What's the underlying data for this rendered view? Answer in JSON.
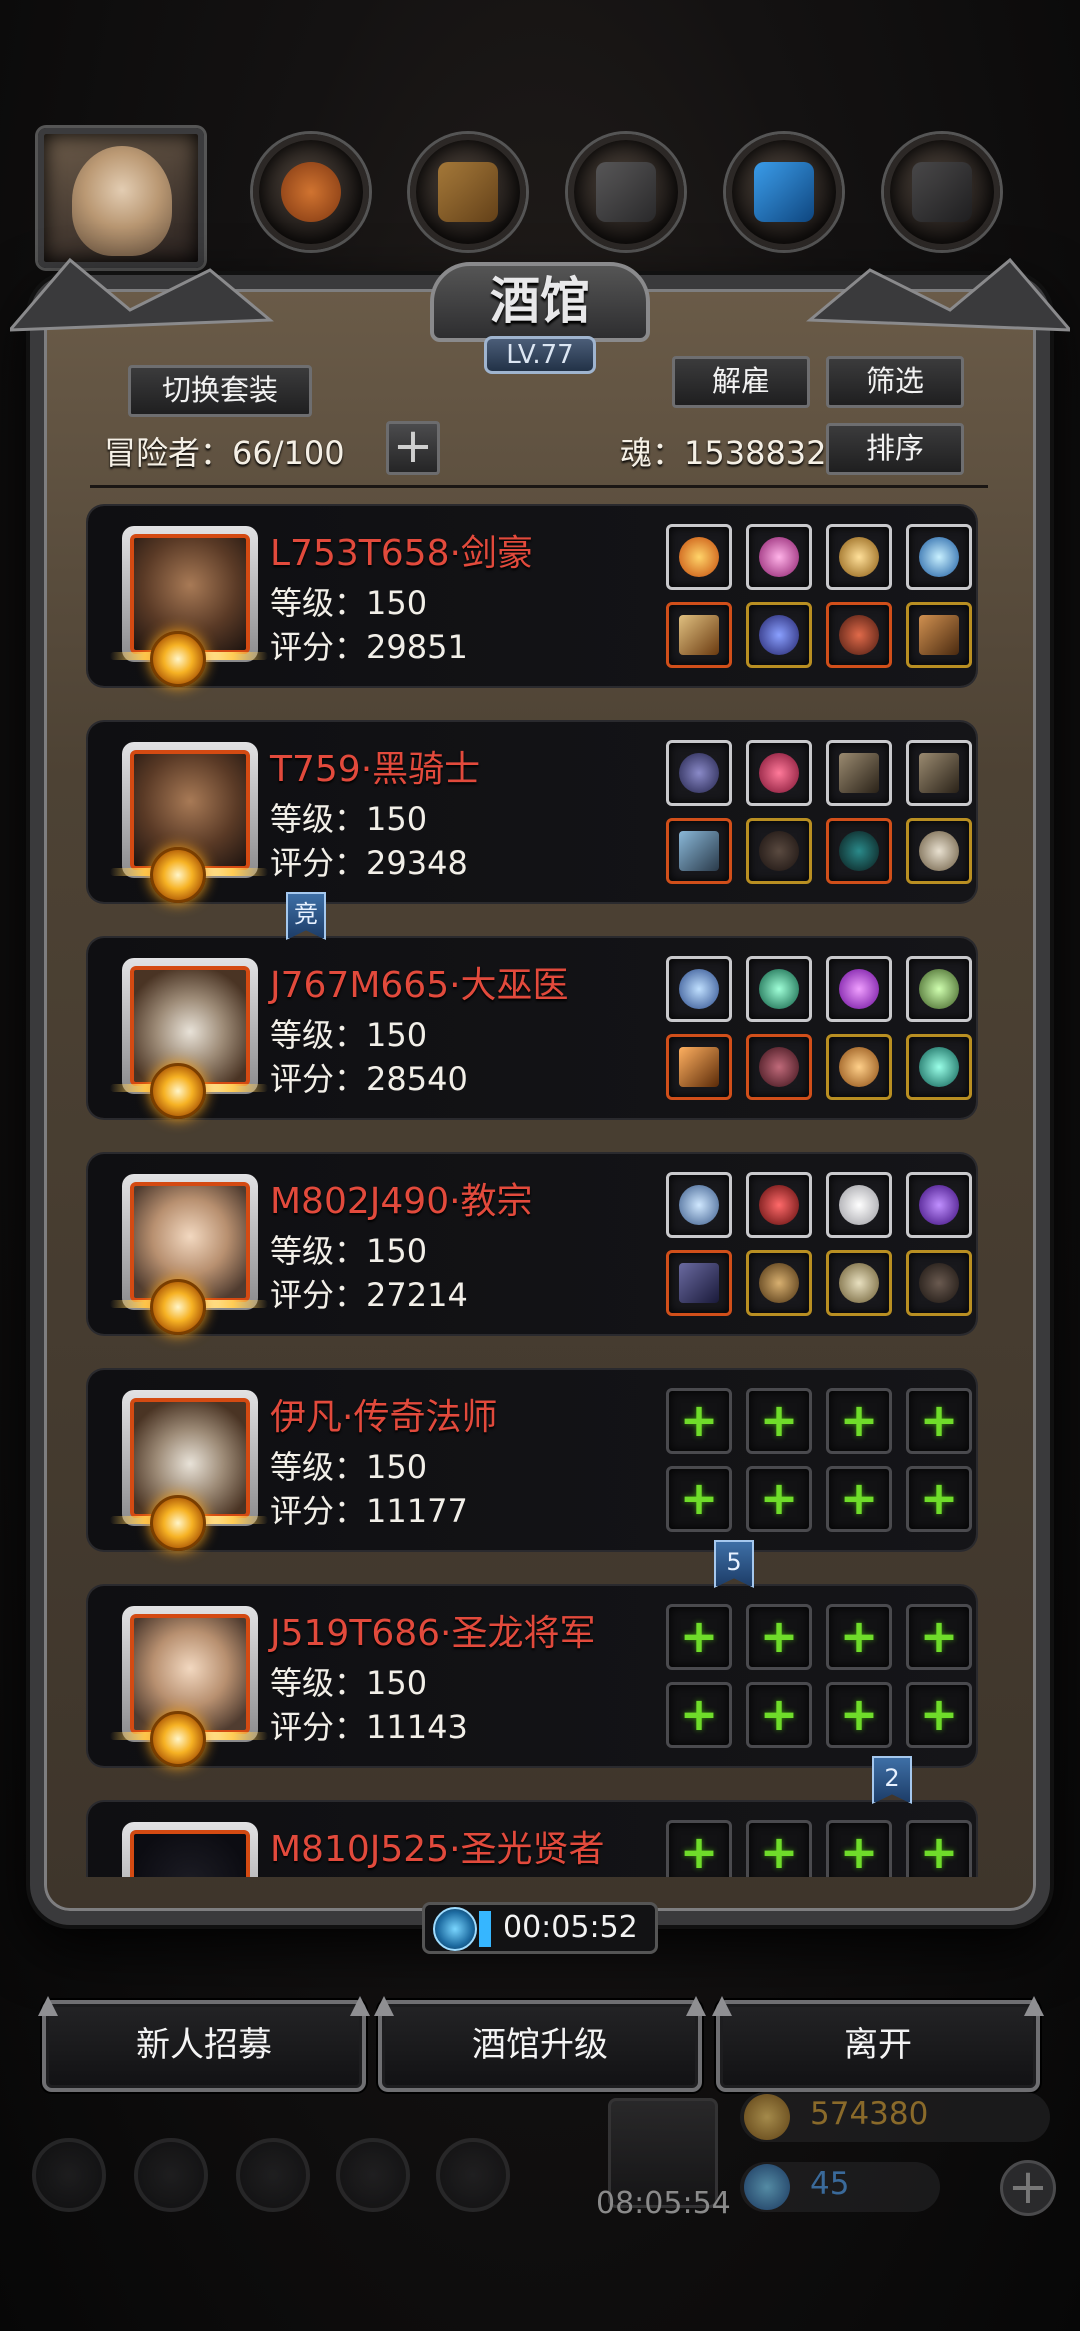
{
  "tavern": {
    "title": "酒馆",
    "level": "LV.77",
    "switch_outfit": "切换套装",
    "dismiss": "解雇",
    "filter": "筛选",
    "sort": "排序",
    "adventurers_label": "冒险者：66/100",
    "soul_label": "魂：1538832"
  },
  "heroes": [
    {
      "name": "L753T658·剑豪",
      "level": "等级：150",
      "score": "评分：29851",
      "portrait": "warrior",
      "slots": [
        "flame-ring",
        "pink-gem",
        "gold-charm",
        "blue-crystal",
        "sword",
        "blue-armor",
        "red-armor",
        "axe"
      ],
      "empty": false
    },
    {
      "name": "T759·黑骑士",
      "level": "等级：150",
      "score": "评分：29348",
      "portrait": "warrior",
      "slots": [
        "dark-helm",
        "ruby",
        "blade",
        "blade",
        "spear",
        "dark-armor",
        "dark-cloak",
        "amulet"
      ],
      "empty": false
    },
    {
      "name": "J767M665·大巫医",
      "level": "等级：150",
      "score": "评分：28540",
      "portrait": "old-mage",
      "slots": [
        "ice-aura",
        "jade-gem",
        "purple-gem",
        "lantern",
        "staff",
        "red-armor",
        "gold-ring",
        "teal-ring"
      ],
      "empty": false
    },
    {
      "name": "M802J490·教宗",
      "level": "等级：150",
      "score": "评分：27214",
      "portrait": "female",
      "slots": [
        "frost-ring",
        "crimson-gem",
        "angel-wing",
        "violet-orb",
        "dark-blade",
        "gold-armor",
        "crown",
        "dark-cape"
      ],
      "empty": false
    },
    {
      "name": "伊凡·传奇法师",
      "level": "等级：150",
      "score": "评分：11177",
      "portrait": "old-mage",
      "slots": [],
      "empty": true
    },
    {
      "name": "J519T686·圣龙将军",
      "level": "等级：150",
      "score": "评分：11143",
      "portrait": "female",
      "slots": [],
      "empty": true
    },
    {
      "name": "M810J525·圣光贤者",
      "level": "",
      "score": "",
      "portrait": "dark",
      "slots": [],
      "empty": true
    }
  ],
  "ribbons": [
    {
      "label": "竞"
    },
    {
      "label": "5"
    },
    {
      "label": "2"
    }
  ],
  "timer": "00:05:52",
  "bottom_buttons": {
    "recruit": "新人招募",
    "upgrade": "酒馆升级",
    "leave": "离开"
  },
  "hud": {
    "gift_timer": "08:05:54",
    "gold": "574380",
    "gems": "45"
  },
  "colors": {
    "name_red": "#e24a3c",
    "plus_green": "#6fdc2a",
    "frame_brown": "#4d4234"
  }
}
